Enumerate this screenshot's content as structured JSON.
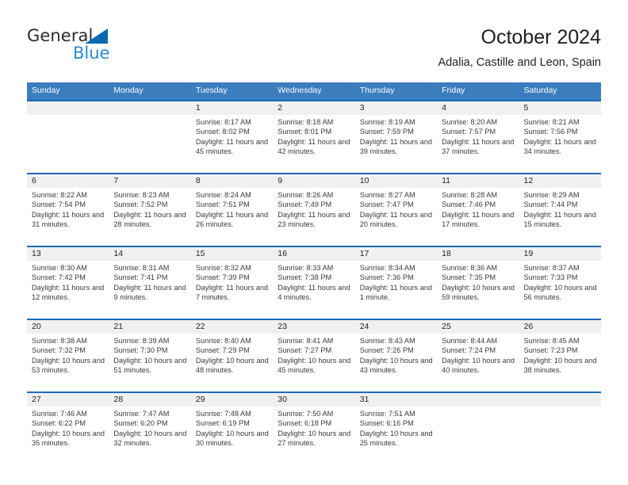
{
  "logo": {
    "word_one": "General",
    "word_two": "Blue",
    "triangle_color": "#0b68b1",
    "blue_color": "#2e8bd0"
  },
  "header": {
    "title": "October 2024",
    "subtitle": "Adalia, Castille and Leon, Spain"
  },
  "theme": {
    "header_band": "#3b7dbd",
    "row_separator": "#1a6cb5",
    "day_number_band": "#f0f0f0",
    "text": "#231f20"
  },
  "weekdays": [
    "Sunday",
    "Monday",
    "Tuesday",
    "Wednesday",
    "Thursday",
    "Friday",
    "Saturday"
  ],
  "weeks": [
    [
      {
        "day": "",
        "sunrise": "",
        "sunset": "",
        "daylight": ""
      },
      {
        "day": "",
        "sunrise": "",
        "sunset": "",
        "daylight": ""
      },
      {
        "day": "1",
        "sunrise": "Sunrise: 8:17 AM",
        "sunset": "Sunset: 8:02 PM",
        "daylight": "Daylight: 11 hours and 45 minutes."
      },
      {
        "day": "2",
        "sunrise": "Sunrise: 8:18 AM",
        "sunset": "Sunset: 8:01 PM",
        "daylight": "Daylight: 11 hours and 42 minutes."
      },
      {
        "day": "3",
        "sunrise": "Sunrise: 8:19 AM",
        "sunset": "Sunset: 7:59 PM",
        "daylight": "Daylight: 11 hours and 39 minutes."
      },
      {
        "day": "4",
        "sunrise": "Sunrise: 8:20 AM",
        "sunset": "Sunset: 7:57 PM",
        "daylight": "Daylight: 11 hours and 37 minutes."
      },
      {
        "day": "5",
        "sunrise": "Sunrise: 8:21 AM",
        "sunset": "Sunset: 7:56 PM",
        "daylight": "Daylight: 11 hours and 34 minutes."
      }
    ],
    [
      {
        "day": "6",
        "sunrise": "Sunrise: 8:22 AM",
        "sunset": "Sunset: 7:54 PM",
        "daylight": "Daylight: 11 hours and 31 minutes."
      },
      {
        "day": "7",
        "sunrise": "Sunrise: 8:23 AM",
        "sunset": "Sunset: 7:52 PM",
        "daylight": "Daylight: 11 hours and 28 minutes."
      },
      {
        "day": "8",
        "sunrise": "Sunrise: 8:24 AM",
        "sunset": "Sunset: 7:51 PM",
        "daylight": "Daylight: 11 hours and 26 minutes."
      },
      {
        "day": "9",
        "sunrise": "Sunrise: 8:26 AM",
        "sunset": "Sunset: 7:49 PM",
        "daylight": "Daylight: 11 hours and 23 minutes."
      },
      {
        "day": "10",
        "sunrise": "Sunrise: 8:27 AM",
        "sunset": "Sunset: 7:47 PM",
        "daylight": "Daylight: 11 hours and 20 minutes."
      },
      {
        "day": "11",
        "sunrise": "Sunrise: 8:28 AM",
        "sunset": "Sunset: 7:46 PM",
        "daylight": "Daylight: 11 hours and 17 minutes."
      },
      {
        "day": "12",
        "sunrise": "Sunrise: 8:29 AM",
        "sunset": "Sunset: 7:44 PM",
        "daylight": "Daylight: 11 hours and 15 minutes."
      }
    ],
    [
      {
        "day": "13",
        "sunrise": "Sunrise: 8:30 AM",
        "sunset": "Sunset: 7:42 PM",
        "daylight": "Daylight: 11 hours and 12 minutes."
      },
      {
        "day": "14",
        "sunrise": "Sunrise: 8:31 AM",
        "sunset": "Sunset: 7:41 PM",
        "daylight": "Daylight: 11 hours and 9 minutes."
      },
      {
        "day": "15",
        "sunrise": "Sunrise: 8:32 AM",
        "sunset": "Sunset: 7:39 PM",
        "daylight": "Daylight: 11 hours and 7 minutes."
      },
      {
        "day": "16",
        "sunrise": "Sunrise: 8:33 AM",
        "sunset": "Sunset: 7:38 PM",
        "daylight": "Daylight: 11 hours and 4 minutes."
      },
      {
        "day": "17",
        "sunrise": "Sunrise: 8:34 AM",
        "sunset": "Sunset: 7:36 PM",
        "daylight": "Daylight: 11 hours and 1 minute."
      },
      {
        "day": "18",
        "sunrise": "Sunrise: 8:36 AM",
        "sunset": "Sunset: 7:35 PM",
        "daylight": "Daylight: 10 hours and 59 minutes."
      },
      {
        "day": "19",
        "sunrise": "Sunrise: 8:37 AM",
        "sunset": "Sunset: 7:33 PM",
        "daylight": "Daylight: 10 hours and 56 minutes."
      }
    ],
    [
      {
        "day": "20",
        "sunrise": "Sunrise: 8:38 AM",
        "sunset": "Sunset: 7:32 PM",
        "daylight": "Daylight: 10 hours and 53 minutes."
      },
      {
        "day": "21",
        "sunrise": "Sunrise: 8:39 AM",
        "sunset": "Sunset: 7:30 PM",
        "daylight": "Daylight: 10 hours and 51 minutes."
      },
      {
        "day": "22",
        "sunrise": "Sunrise: 8:40 AM",
        "sunset": "Sunset: 7:29 PM",
        "daylight": "Daylight: 10 hours and 48 minutes."
      },
      {
        "day": "23",
        "sunrise": "Sunrise: 8:41 AM",
        "sunset": "Sunset: 7:27 PM",
        "daylight": "Daylight: 10 hours and 45 minutes."
      },
      {
        "day": "24",
        "sunrise": "Sunrise: 8:43 AM",
        "sunset": "Sunset: 7:26 PM",
        "daylight": "Daylight: 10 hours and 43 minutes."
      },
      {
        "day": "25",
        "sunrise": "Sunrise: 8:44 AM",
        "sunset": "Sunset: 7:24 PM",
        "daylight": "Daylight: 10 hours and 40 minutes."
      },
      {
        "day": "26",
        "sunrise": "Sunrise: 8:45 AM",
        "sunset": "Sunset: 7:23 PM",
        "daylight": "Daylight: 10 hours and 38 minutes."
      }
    ],
    [
      {
        "day": "27",
        "sunrise": "Sunrise: 7:46 AM",
        "sunset": "Sunset: 6:22 PM",
        "daylight": "Daylight: 10 hours and 35 minutes."
      },
      {
        "day": "28",
        "sunrise": "Sunrise: 7:47 AM",
        "sunset": "Sunset: 6:20 PM",
        "daylight": "Daylight: 10 hours and 32 minutes."
      },
      {
        "day": "29",
        "sunrise": "Sunrise: 7:48 AM",
        "sunset": "Sunset: 6:19 PM",
        "daylight": "Daylight: 10 hours and 30 minutes."
      },
      {
        "day": "30",
        "sunrise": "Sunrise: 7:50 AM",
        "sunset": "Sunset: 6:18 PM",
        "daylight": "Daylight: 10 hours and 27 minutes."
      },
      {
        "day": "31",
        "sunrise": "Sunrise: 7:51 AM",
        "sunset": "Sunset: 6:16 PM",
        "daylight": "Daylight: 10 hours and 25 minutes."
      },
      {
        "day": "",
        "sunrise": "",
        "sunset": "",
        "daylight": ""
      },
      {
        "day": "",
        "sunrise": "",
        "sunset": "",
        "daylight": ""
      }
    ]
  ]
}
